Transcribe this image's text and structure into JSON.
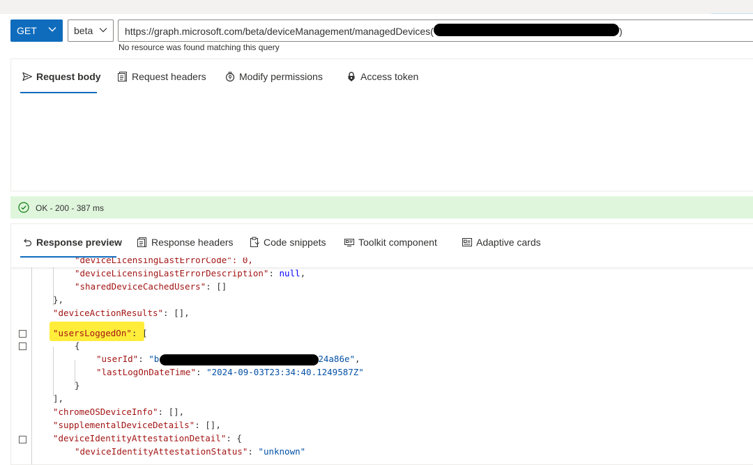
{
  "url_bar": {
    "method": "GET",
    "version": "beta",
    "url": "https://graph.microsoft.com/beta/deviceManagement/managedDevices(",
    "url_close": ")",
    "hint": "No resource was found matching this query"
  },
  "request_tabs": [
    {
      "label": "Request body",
      "icon": "send-icon",
      "active": true
    },
    {
      "label": "Request headers",
      "icon": "headers-icon",
      "active": false
    },
    {
      "label": "Modify permissions",
      "icon": "permissions-icon",
      "active": false
    },
    {
      "label": "Access token",
      "icon": "lock-icon",
      "active": false
    }
  ],
  "status": {
    "text": "OK - 200 - 387 ms",
    "icon": "check-circle-icon",
    "color": "#dff6dd"
  },
  "response_tabs": [
    {
      "label": "Response preview",
      "icon": "undo-icon",
      "active": true
    },
    {
      "label": "Response headers",
      "icon": "headers-icon",
      "active": false
    },
    {
      "label": "Code snippets",
      "icon": "clipboard-icon",
      "active": false
    },
    {
      "label": "Toolkit component",
      "icon": "toolkit-icon",
      "active": false
    },
    {
      "label": "Adaptive cards",
      "icon": "card-icon",
      "active": false
    }
  ],
  "json_lines": {
    "l0_key": "\"deviceLicensingLastErrorDescription\"",
    "l0_val": "null",
    "l1_key": "\"sharedDeviceCachedUsers\"",
    "l1_val": "[]",
    "l2": "},",
    "l3_key": "\"deviceActionResults\"",
    "l3_val": "[],",
    "l4_key": "\"usersLoggedOn\"",
    "l4_val": "[",
    "l5": "{",
    "l6_key": "\"userId\"",
    "l6_val_a": "\"b",
    "l6_val_b": "24a86e\"",
    "l7_key": "\"lastLogOnDateTime\"",
    "l7_val": "\"2024-09-03T23:34:40.1249587Z\"",
    "l8": "}",
    "l9": "],",
    "l10_key": "\"chromeOSDeviceInfo\"",
    "l10_val": "[],",
    "l11_key": "\"supplementalDeviceDetails\"",
    "l11_val": "[],",
    "l12_key": "\"deviceIdentityAttestationDetail\"",
    "l12_val": "{",
    "l13_key": "\"deviceIdentityAttestationStatus\"",
    "l13_val": "\"unknown\""
  },
  "colors": {
    "accent": "#0f6cbd",
    "highlight": "#ffed3a",
    "json_key": "#a31515",
    "json_string": "#0451a5",
    "json_keyword": "#0000ff"
  }
}
